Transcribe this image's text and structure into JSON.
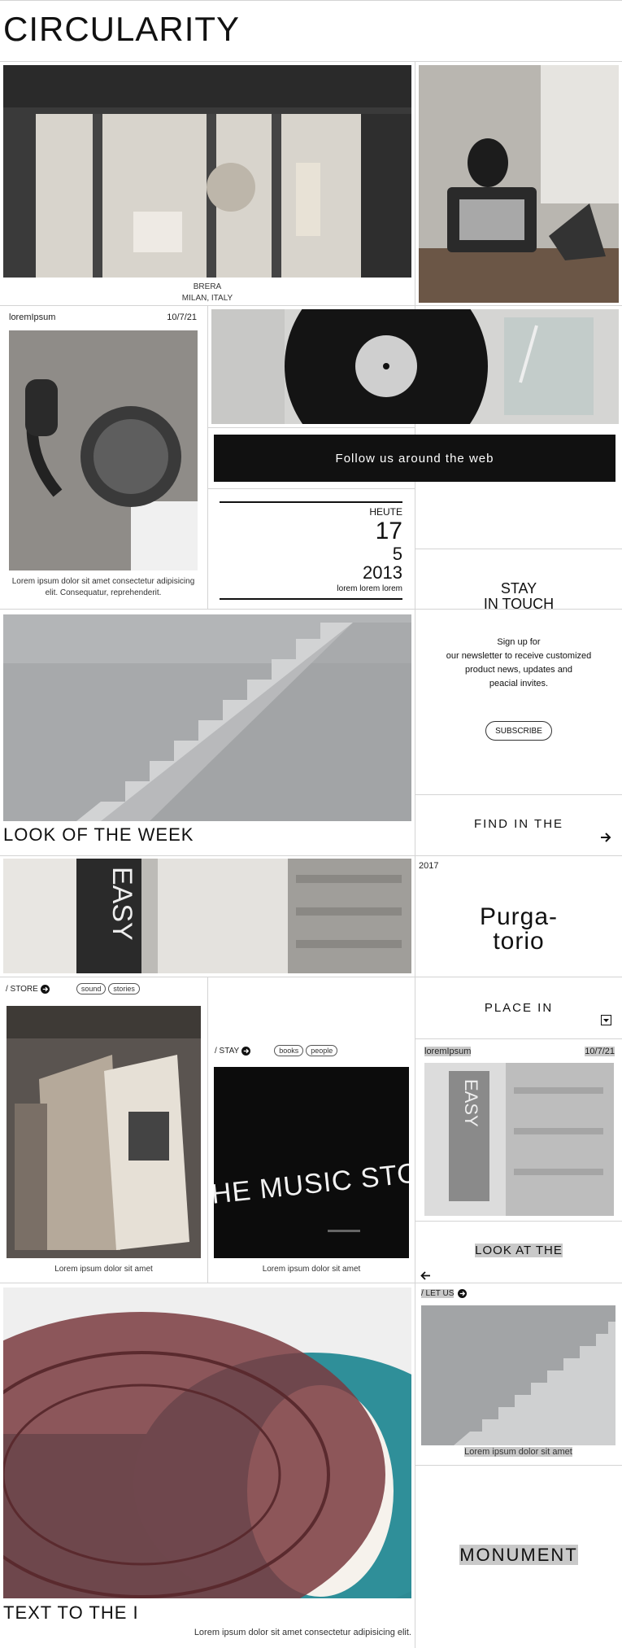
{
  "brand": {
    "title": "CIRCULARITY"
  },
  "store_caption": {
    "line1": "BRERA",
    "line2": "MILAN, ITALY"
  },
  "post1": {
    "author": "loremIpsum",
    "date": "10/7/21",
    "caption": "Lorem ipsum dolor sit amet consectetur adipisicing elit. Consequatur, reprehenderit."
  },
  "follow": {
    "label": "Follow us around the web"
  },
  "date_block": {
    "heading": "HEUTE",
    "day": "17",
    "month": "5",
    "year": "2013",
    "footer": "lorem lorem lorem"
  },
  "newsletter": {
    "title_line1": "STAY",
    "title_line2": "IN TOUCH",
    "body_line1": "Sign up for",
    "body_line2": "our newsletter to receive customized",
    "body_line3": "product news, updates and",
    "body_line4": "peacial invites.",
    "button": "SUBSCRIBE"
  },
  "look_of_week": {
    "title": "LOOK OF THE WEEK"
  },
  "find_in": {
    "label": "FIND IN THE"
  },
  "purgatorio": {
    "year": "2017",
    "line1": "Purga-",
    "line2": "torio"
  },
  "store_card": {
    "label": "/ STORE",
    "tags": [
      "sound",
      "stories"
    ],
    "caption": "Lorem ipsum dolor sit amet"
  },
  "place_in": {
    "label": "PLACE IN"
  },
  "stay_card": {
    "label": "/ STAY",
    "tags": [
      "books",
      "people"
    ],
    "caption": "Lorem ipsum dolor sit amet"
  },
  "post2": {
    "author": "loremIpsum",
    "date": "10/7/21"
  },
  "look_at": {
    "label": "LOOK AT THE"
  },
  "let_us": {
    "label": "/ LET US",
    "caption": "Lorem ipsum dolor sit amet"
  },
  "text_to": {
    "title": "TEXT TO THE I",
    "caption": "Lorem ipsum dolor sit amet consectetur adipisicing elit."
  },
  "monument": {
    "label": "MONUMENT"
  },
  "icons": {
    "arrow_right": "arrow-right-icon",
    "dropdown": "dropdown-square-icon",
    "arrow_left": "arrow-left-icon",
    "circle_arrow": "circle-arrow-icon"
  },
  "colors": {
    "follow_bg": "#111111",
    "highlight": "#c9c9c9",
    "line": "#d4d4d4"
  }
}
